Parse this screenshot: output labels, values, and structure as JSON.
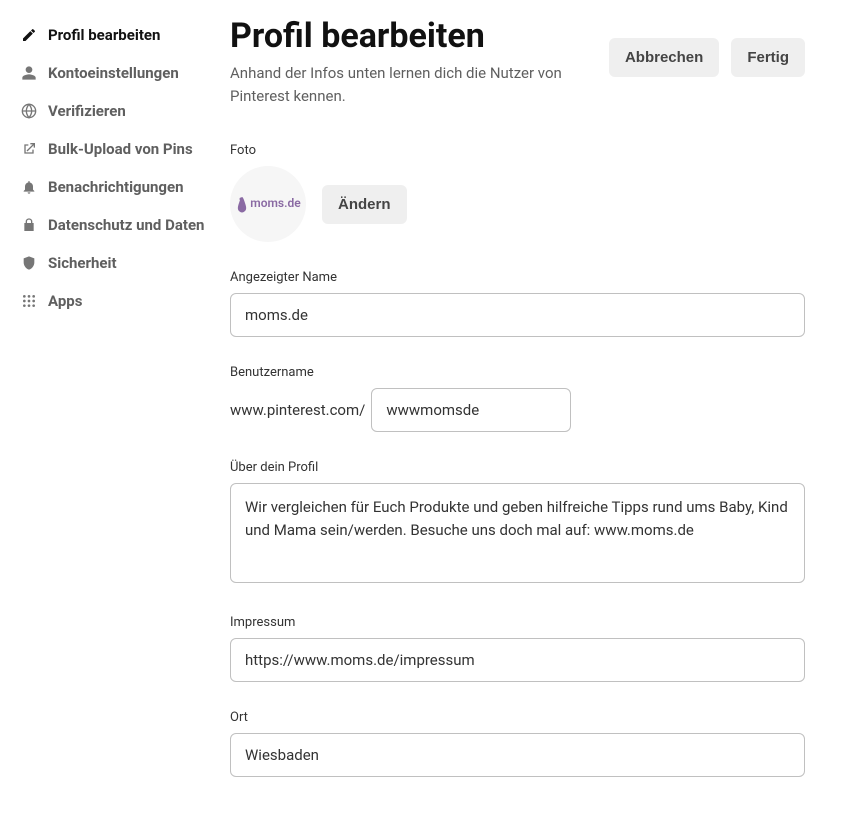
{
  "sidebar": {
    "items": [
      {
        "label": "Profil bearbeiten"
      },
      {
        "label": "Kontoeinstellungen"
      },
      {
        "label": "Verifizieren"
      },
      {
        "label": "Bulk-Upload von Pins"
      },
      {
        "label": "Benachrichtigungen"
      },
      {
        "label": "Datenschutz und Daten"
      },
      {
        "label": "Sicherheit"
      },
      {
        "label": "Apps"
      }
    ]
  },
  "header": {
    "title": "Profil bearbeiten",
    "subtitle": "Anhand der Infos unten lernen dich die Nutzer von Pinterest kennen.",
    "cancel": "Abbrechen",
    "done": "Fertig"
  },
  "form": {
    "photo_label": "Foto",
    "avatar_text": "moms.de",
    "change_label": "Ändern",
    "display_name_label": "Angezeigter Name",
    "display_name_value": "moms.de",
    "username_label": "Benutzername",
    "username_prefix": "www.pinterest.com/",
    "username_value": "wwwmomsde",
    "about_label": "Über dein Profil",
    "about_value": "Wir vergleichen für Euch Produkte und geben hilfreiche Tipps rund ums Baby, Kind und Mama sein/werden. Besuche uns doch mal auf: www.moms.de",
    "impressum_label": "Impressum",
    "impressum_value": "https://www.moms.de/impressum",
    "location_label": "Ort",
    "location_value": "Wiesbaden"
  }
}
